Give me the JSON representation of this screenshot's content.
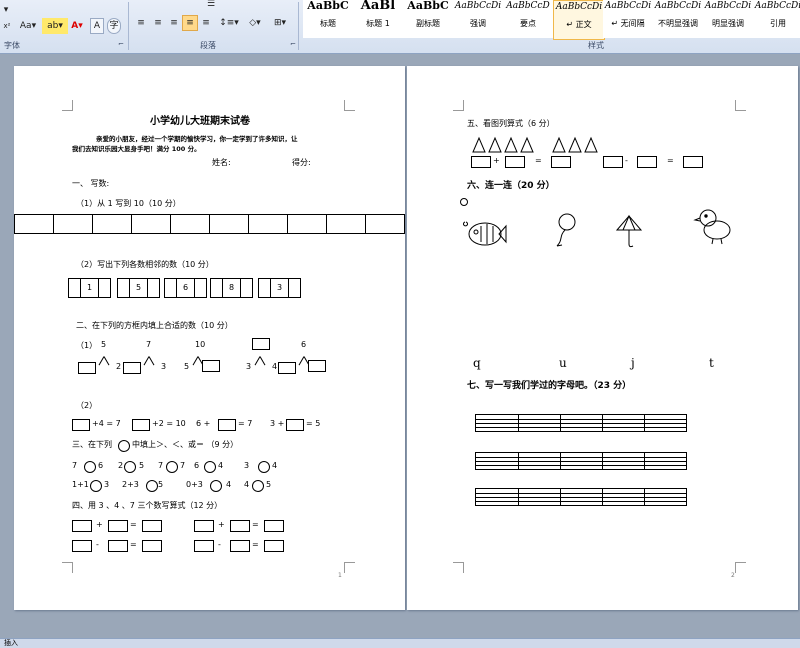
{
  "ribbon": {
    "font_group": {
      "label": "字体",
      "text_size_label": "Aa",
      "highlight_label": "ab",
      "font_color_label": "A",
      "char_border_label": "A",
      "char_circle_label": "字",
      "subscript_label": "x²"
    },
    "para_group": {
      "label": "段落"
    },
    "styles_group": {
      "label": "样式",
      "tiles": [
        {
          "sample": "AaBbC",
          "name": "标题"
        },
        {
          "sample": "AaBl",
          "name": "标题 1"
        },
        {
          "sample": "AaBbC",
          "name": "副标题"
        },
        {
          "sample": "AaBbCcDi",
          "name": "强调"
        },
        {
          "sample": "AaBbCcD",
          "name": "要点"
        },
        {
          "sample": "AaBbCcDi",
          "name": "↵ 正文"
        },
        {
          "sample": "AaBbCcDi",
          "name": "↵ 无间隔"
        },
        {
          "sample": "AaBbCcDi",
          "name": "不明显强调"
        },
        {
          "sample": "AaBbCcDi",
          "name": "明显强调"
        },
        {
          "sample": "AaBbCcDi",
          "name": "引用"
        }
      ]
    }
  },
  "status": {
    "mode": "插入"
  },
  "page1": {
    "title": "小学幼儿大班期末试卷",
    "intro_line1": "亲爱的小朋友，经过一个学期的愉快学习，你一定学到了许多知识，让",
    "intro_line2": "我们去知识乐园大显身手吧！满分 100 分。",
    "name_label": "姓名:",
    "score_label": "得分:",
    "s1": "一、  写数:",
    "s1_1": "（1）从 1 写到 10（10 分）",
    "s1_2": "（2）写出下列各数相邻的数（10 分）",
    "s1_2_nums": [
      "1",
      "5",
      "6",
      "8",
      "3"
    ],
    "s2": "二、在下列的方框内填上合适的数（10 分）",
    "s2_1": "（1）",
    "tree_tops": [
      "5",
      "7",
      "10",
      "",
      "6"
    ],
    "tree_l": [
      "",
      "",
      "5",
      "3",
      ""
    ],
    "tree_r": [
      "2",
      "3",
      "",
      "4",
      ""
    ],
    "s2_2": "（2）",
    "eq_row": [
      "+4 = 7",
      "+2 = 10",
      "6 +",
      "= 7",
      "3 +",
      "= 5"
    ],
    "s3": "三、在下列",
    "s3_b": "中填上＞、＜、或＝  （9 分）",
    "cmp1": [
      "7",
      "6",
      "2",
      "5",
      "7",
      "7",
      "6",
      "4",
      "3",
      "4"
    ],
    "cmp2": [
      "1+1",
      "3",
      "2+3",
      "5",
      "0+3",
      "4",
      "4",
      "5"
    ],
    "s4": "四、用 3 、4 、7 三个数写算式（12 分）",
    "ops": [
      "+",
      "=",
      "+",
      "=",
      "-",
      "=",
      "-",
      "="
    ],
    "page_no": "1"
  },
  "page2": {
    "s5": "五、看图列算式（6 分）",
    "s5_ops": [
      "+",
      "=",
      "-",
      "="
    ],
    "s6": "六、连一连（20 分）",
    "letters": [
      "q",
      "u",
      "j",
      "t"
    ],
    "s7": "七、写一写我们学过的字母吧。（23 分）",
    "page_no": "2"
  }
}
